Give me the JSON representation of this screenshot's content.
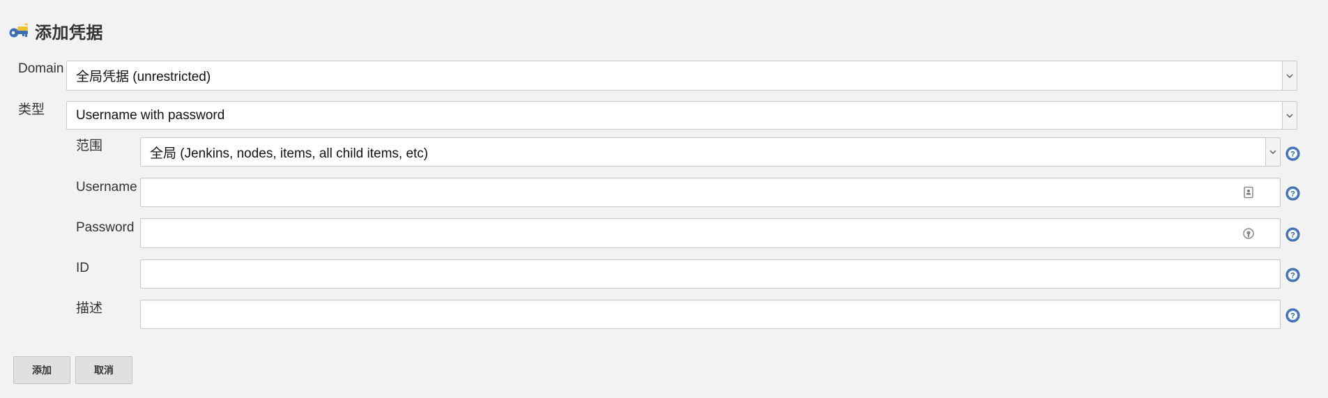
{
  "header": {
    "title": "添加凭据",
    "icon": "key-icon"
  },
  "form": {
    "domain": {
      "label": "Domain",
      "selected": "全局凭据 (unrestricted)"
    },
    "kind": {
      "label": "类型",
      "selected": "Username with password"
    },
    "scope": {
      "label": "范围",
      "selected": "全局 (Jenkins, nodes, items, all child items, etc)"
    },
    "username": {
      "label": "Username",
      "value": "",
      "icon": "contact-card-icon"
    },
    "password": {
      "label": "Password",
      "value": "",
      "icon": "password-key-icon"
    },
    "id": {
      "label": "ID",
      "value": ""
    },
    "description": {
      "label": "描述",
      "value": ""
    }
  },
  "help_icon": "help-icon",
  "buttons": {
    "add_label": "添加",
    "cancel_label": "取消"
  },
  "colors": {
    "background": "#f2f2f2",
    "help_blue": "#4a7dbf",
    "key_yellow": "#f2c12e",
    "key_blue": "#3d6fb6"
  }
}
